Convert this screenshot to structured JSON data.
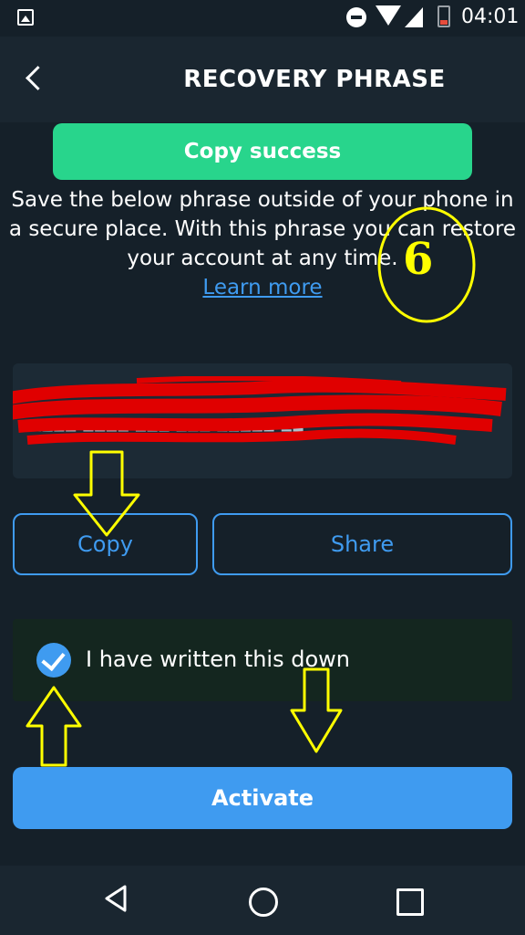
{
  "status_bar": {
    "time": "04:01"
  },
  "header": {
    "title": "RECOVERY PHRASE",
    "back_icon": "chevron-left-icon"
  },
  "toast": {
    "text": "Copy success",
    "color": "#28d58c"
  },
  "description": {
    "text": "Save the below phrase outside of your phone in a secure place. With this phrase you can restore your account at any time."
  },
  "learn_more": {
    "label": "Learn more"
  },
  "actions": {
    "copy_label": "Copy",
    "share_label": "Share"
  },
  "confirmation": {
    "label": "I have written this down",
    "checked": true
  },
  "activate": {
    "label": "Activate"
  },
  "annotation": {
    "number": "6"
  },
  "colors": {
    "accent": "#3f9bf0",
    "background": "#152029",
    "annotation": "#ffff00",
    "redaction": "#e00000"
  }
}
